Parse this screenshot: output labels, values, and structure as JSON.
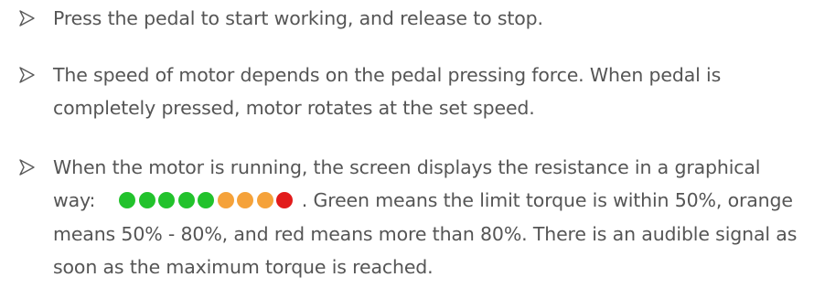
{
  "items": [
    {
      "icon": "arrow-bullet-icon",
      "lines": [
        "Press the pedal to start working, and release to stop."
      ]
    },
    {
      "icon": "arrow-bullet-icon",
      "lines": [
        "The speed of motor depends on the pedal pressing force. When pedal is",
        "completely pressed, motor rotates at the set speed."
      ]
    },
    {
      "icon": "arrow-bullet-icon",
      "line1": "When the motor is running, the screen displays the resistance in a graphical",
      "line2_before": "way:",
      "line2_after": ". Green means the limit torque is within 50%, orange",
      "line3": "means 50% - 80%, and red means more than 80%. There is an audible signal as",
      "line4": "soon as the maximum torque is reached."
    }
  ],
  "indicator": {
    "colors": {
      "green": "#22c22c",
      "orange": "#f5a23a",
      "red": "#e21b1b"
    },
    "dots": [
      "green",
      "green",
      "green",
      "green",
      "green",
      "orange",
      "orange",
      "orange",
      "red"
    ]
  }
}
